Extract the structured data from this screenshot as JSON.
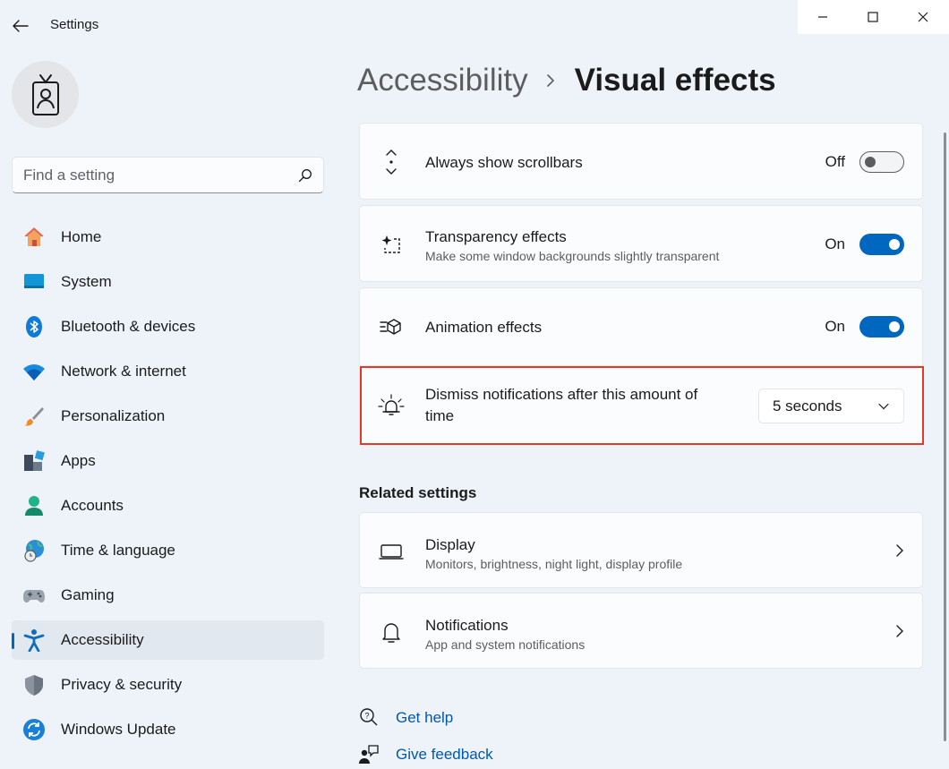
{
  "window": {
    "title": "Settings",
    "controls": [
      "minimize-icon",
      "maximize-icon",
      "close-icon"
    ]
  },
  "search": {
    "placeholder": "Find a setting",
    "icon": "search-icon"
  },
  "sidebar": {
    "items": [
      {
        "label": "Home",
        "icon": "home-icon"
      },
      {
        "label": "System",
        "icon": "system-icon"
      },
      {
        "label": "Bluetooth & devices",
        "icon": "bluetooth-icon"
      },
      {
        "label": "Network & internet",
        "icon": "wifi-icon"
      },
      {
        "label": "Personalization",
        "icon": "brush-icon"
      },
      {
        "label": "Apps",
        "icon": "apps-icon"
      },
      {
        "label": "Accounts",
        "icon": "accounts-icon"
      },
      {
        "label": "Time & language",
        "icon": "globe-clock-icon"
      },
      {
        "label": "Gaming",
        "icon": "gamepad-icon"
      },
      {
        "label": "Accessibility",
        "icon": "accessibility-icon",
        "active": true
      },
      {
        "label": "Privacy & security",
        "icon": "shield-icon"
      },
      {
        "label": "Windows Update",
        "icon": "update-icon"
      }
    ]
  },
  "breadcrumb": {
    "parent": "Accessibility",
    "current": "Visual effects"
  },
  "settings": {
    "scrollbars": {
      "title": "Always show scrollbars",
      "state": "Off",
      "on": false,
      "icon": "scrollbar-arrows-icon"
    },
    "transparency": {
      "title": "Transparency effects",
      "subtitle": "Make some window backgrounds slightly transparent",
      "state": "On",
      "on": true,
      "icon": "transparency-icon"
    },
    "animation": {
      "title": "Animation effects",
      "state": "On",
      "on": true,
      "icon": "animation-icon"
    },
    "dismiss": {
      "title": "Dismiss notifications after this amount of time",
      "value": "5 seconds",
      "icon": "notification-timer-icon"
    }
  },
  "related": {
    "title": "Related settings",
    "display": {
      "title": "Display",
      "subtitle": "Monitors, brightness, night light, display profile",
      "icon": "monitor-icon"
    },
    "notifications": {
      "title": "Notifications",
      "subtitle": "App and system notifications",
      "icon": "bell-icon"
    }
  },
  "links": {
    "help": "Get help",
    "feedback": "Give feedback"
  },
  "colors": {
    "accent": "#0067c0",
    "highlight": "#e03b24",
    "background": "#eef3f9"
  }
}
